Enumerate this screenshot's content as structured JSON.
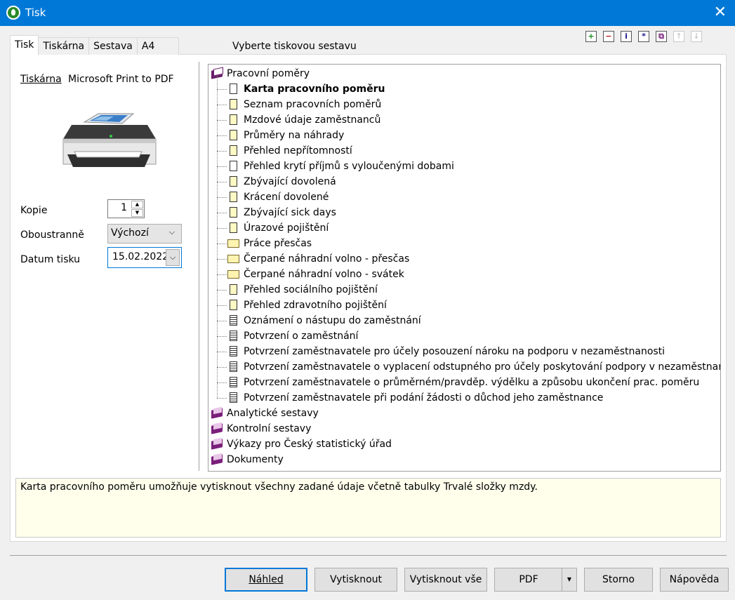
{
  "window": {
    "title": "Tisk"
  },
  "tabs": [
    "Tisk",
    "Tiskárna",
    "Sestava",
    "A4"
  ],
  "header": {
    "select_label": "Vyberte tiskovou sestavu"
  },
  "toolbar": {
    "icons": [
      "expand-icon",
      "collapse-icon",
      "info-icon",
      "asterisk-icon",
      "copy-icon",
      "move-up-icon",
      "move-down-icon"
    ]
  },
  "printer": {
    "label": "Tiskárna",
    "name": "Microsoft Print to PDF"
  },
  "form": {
    "copies_label": "Kopie",
    "copies_value": "1",
    "duplex_label": "Oboustranně",
    "duplex_value": "Výchozí",
    "date_label": "Datum tisku",
    "date_value": "15.02.2022"
  },
  "tree": {
    "root": "Pracovní poměry",
    "children": [
      {
        "label": "Karta pracovního poměru",
        "icon": "white"
      },
      {
        "label": "Seznam pracovních poměrů",
        "icon": "yellow"
      },
      {
        "label": "Mzdové údaje zaměstnanců",
        "icon": "yellow"
      },
      {
        "label": "Průměry na náhrady",
        "icon": "yellow"
      },
      {
        "label": "Přehled nepřítomností",
        "icon": "yellow"
      },
      {
        "label": "Přehled krytí příjmů s vyloučenými dobami",
        "icon": "white"
      },
      {
        "label": "Zbývající dovolená",
        "icon": "yellow"
      },
      {
        "label": "Krácení dovolené",
        "icon": "yellow"
      },
      {
        "label": "Zbývající sick days",
        "icon": "yellow"
      },
      {
        "label": "Úrazové pojištění",
        "icon": "yellow"
      },
      {
        "label": "Práce přesčas",
        "icon": "folder"
      },
      {
        "label": "Čerpané náhradní volno - přesčas",
        "icon": "folder"
      },
      {
        "label": "Čerpané náhradní volno - svátek",
        "icon": "folder"
      },
      {
        "label": "Přehled sociálního pojištění",
        "icon": "yellow"
      },
      {
        "label": "Přehled zdravotního pojištění",
        "icon": "yellow"
      },
      {
        "label": "Oznámení o nástupu do zaměstnání",
        "icon": "lined"
      },
      {
        "label": "Potvrzení o zaměstnání",
        "icon": "lined"
      },
      {
        "label": "Potvrzení zaměstnavatele pro účely posouzení nároku na podporu v nezaměstnanosti",
        "icon": "lined"
      },
      {
        "label": "Potvrzení zaměstnavatele o vyplacení odstupného pro účely poskytování podpory v nezaměstnanosti",
        "icon": "lined"
      },
      {
        "label": "Potvrzení zaměstnavatele o průměrném/pravděp. výdělku a způsobu ukončení prac. poměru",
        "icon": "lined"
      },
      {
        "label": "Potvrzení zaměstnavatele při podání žádosti o důchod jeho zaměstnance",
        "icon": "lined"
      }
    ],
    "groups": [
      "Analytické sestavy",
      "Kontrolní sestavy",
      "Výkazy pro Český statistický úřad",
      "Dokumenty"
    ]
  },
  "description": "Karta pracovního poměru umožňuje vytisknout všechny zadané údaje včetně tabulky Trvalé složky mzdy.",
  "buttons": {
    "preview": "Náhled",
    "print": "Vytisknout",
    "print_all": "Vytisknout vše",
    "pdf": "PDF",
    "cancel": "Storno",
    "help": "Nápověda"
  }
}
